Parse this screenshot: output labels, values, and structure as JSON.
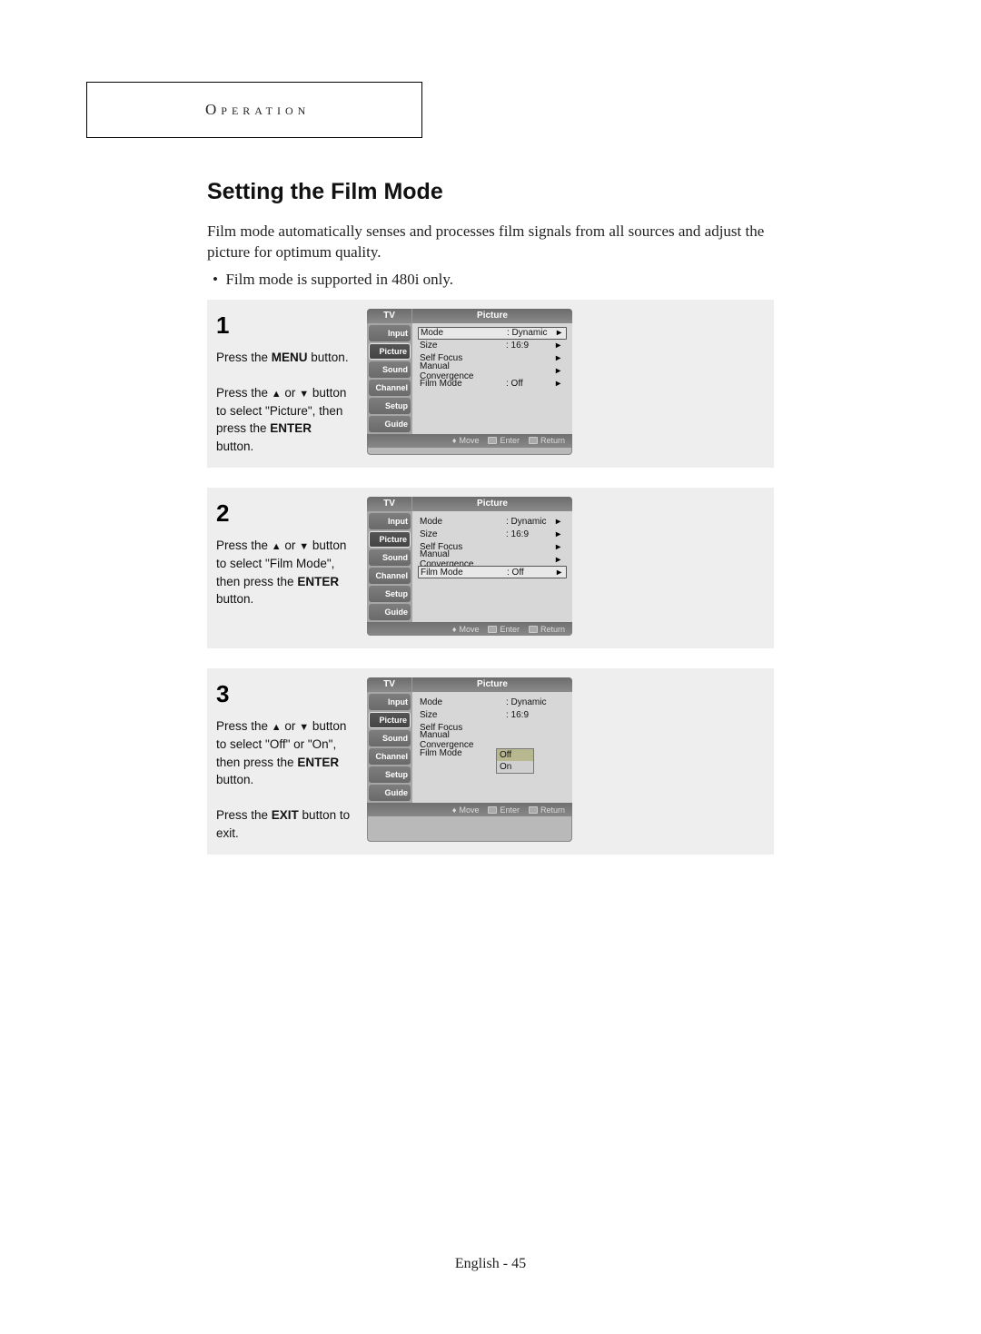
{
  "header": "Operation",
  "title": "Setting the Film Mode",
  "intro": "Film mode automatically senses and processes film signals from all sources and adjust the picture for optimum quality.",
  "bullet": "Film mode is supported in 480i only.",
  "steps": {
    "s1": {
      "num": "1",
      "p1_a": "Press the ",
      "p1_b": "MENU",
      "p1_c": " button.",
      "p2_a": "Press the ",
      "p2_b": " or ",
      "p2_c": " button to select \"Picture\", then press the ",
      "p2_d": "ENTER",
      "p2_e": " button."
    },
    "s2": {
      "num": "2",
      "p1_a": "Press the ",
      "p1_b": " or ",
      "p1_c": " button to select \"Film Mode\", then press the ",
      "p1_d": "ENTER",
      "p1_e": " button."
    },
    "s3": {
      "num": "3",
      "p1_a": "Press the ",
      "p1_b": " or ",
      "p1_c": " button to select \"Off\" or \"On\", then press the ",
      "p1_d": "ENTER",
      "p1_e": " button.",
      "p2_a": "Press the ",
      "p2_b": "EXIT",
      "p2_c": " button to exit."
    }
  },
  "osd_common": {
    "tv": "TV",
    "title": "Picture",
    "sidebar": [
      "Input",
      "Picture",
      "Sound",
      "Channel",
      "Setup",
      "Guide"
    ],
    "rows": {
      "mode_l": "Mode",
      "mode_v": ": Dynamic",
      "size_l": "Size",
      "size_v": ": 16:9",
      "self_l": "Self Focus",
      "conv_l": "Manual Convergence",
      "film_l": "Film Mode",
      "film_v": ": Off"
    },
    "dropdown": {
      "off": "Off",
      "on": "On"
    },
    "footer": {
      "move": "Move",
      "enter": "Enter",
      "return": "Return"
    }
  },
  "footer": "English - 45"
}
